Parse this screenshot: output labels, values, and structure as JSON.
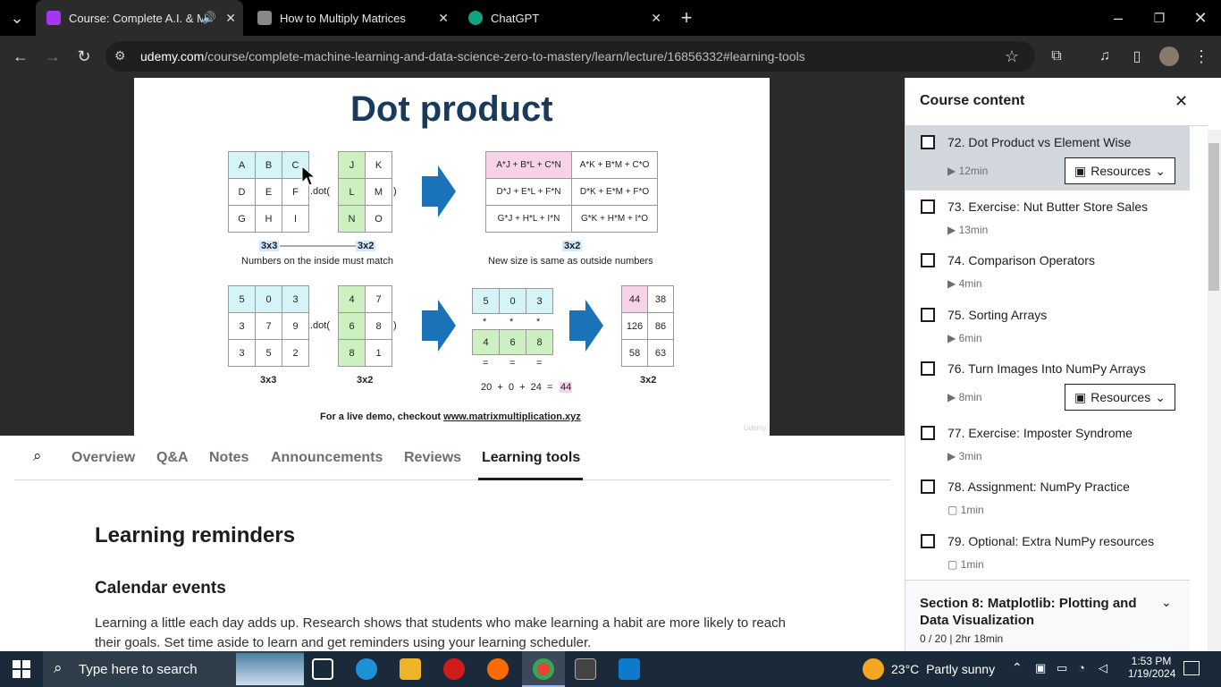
{
  "tabs": [
    {
      "title": "Course: Complete A.I. & Ma",
      "color": "#a435f0"
    },
    {
      "title": "How to Multiply Matrices",
      "color": "#888888"
    },
    {
      "title": "ChatGPT",
      "color": "#10a37f"
    }
  ],
  "url": {
    "domain": "udemy.com",
    "path": "/course/complete-machine-learning-and-data-science-zero-to-mastery/learn/lecture/16856332#learning-tools"
  },
  "slide": {
    "title": "Dot product",
    "m1": [
      [
        "A",
        "B",
        "C"
      ],
      [
        "D",
        "E",
        "F"
      ],
      [
        "G",
        "H",
        "I"
      ]
    ],
    "m2": [
      [
        "J",
        "K"
      ],
      [
        "L",
        "M"
      ],
      [
        "N",
        "O"
      ]
    ],
    "m3": [
      [
        "A*J + B*L + C*N",
        "A*K + B*M + C*O"
      ],
      [
        "D*J + E*L + F*N",
        "D*K + E*M + F*O"
      ],
      [
        "G*J + H*L + I*N",
        "G*K + H*M + I*O"
      ]
    ],
    "dot": ".dot(",
    "close": ")",
    "lbl_3x3": "3x3",
    "lbl_3x2": "3x2",
    "inside": "Numbers on the inside must match",
    "outside": "New size is same as outside numbers",
    "n1": [
      [
        "5",
        "0",
        "3"
      ],
      [
        "3",
        "7",
        "9"
      ],
      [
        "3",
        "5",
        "2"
      ]
    ],
    "n2": [
      [
        "4",
        "7"
      ],
      [
        "6",
        "8"
      ],
      [
        "8",
        "1"
      ]
    ],
    "row": [
      "5",
      "0",
      "3"
    ],
    "col": [
      "4",
      "6",
      "8"
    ],
    "star": "*",
    "eq": "=",
    "sum": "20  +  0  +  24  =",
    "sumres": "44",
    "res": [
      [
        "44",
        "38"
      ],
      [
        "126",
        "86"
      ],
      [
        "58",
        "63"
      ]
    ],
    "demo_pre": "For a live demo, checkout ",
    "demo_link": "www.matrixmultiplication.xyz",
    "watermark": "Udemy"
  },
  "navtabs": [
    "Overview",
    "Q&A",
    "Notes",
    "Announcements",
    "Reviews",
    "Learning tools"
  ],
  "content": {
    "h1": "Learning reminders",
    "h2": "Calendar events",
    "p": "Learning a little each day adds up. Research shows that students who make learning a habit are more likely to reach their goals. Set time aside to learn and get reminders using your learning scheduler."
  },
  "sidebar": {
    "title": "Course content",
    "items": [
      {
        "title": "72. Dot Product vs Element Wise",
        "dur": "12min",
        "res": true
      },
      {
        "title": "73. Exercise: Nut Butter Store Sales",
        "dur": "13min",
        "res": false
      },
      {
        "title": "74. Comparison Operators",
        "dur": "4min",
        "res": false
      },
      {
        "title": "75. Sorting Arrays",
        "dur": "6min",
        "res": false
      },
      {
        "title": "76. Turn Images Into NumPy Arrays",
        "dur": "8min",
        "res": true
      },
      {
        "title": "77. Exercise: Imposter Syndrome",
        "dur": "3min",
        "res": false
      },
      {
        "title": "78. Assignment: NumPy Practice",
        "dur": "1min",
        "res": false
      },
      {
        "title": "79. Optional: Extra NumPy resources",
        "dur": "1min",
        "res": false
      }
    ],
    "resources_label": "Resources",
    "section_title": "Section 8: Matplotlib: Plotting and Data Visualization",
    "section_meta": "0 / 20 | 2hr 18min"
  },
  "taskbar": {
    "search": "Type here to search",
    "temp": "23°C",
    "weather": "Partly sunny",
    "time": "1:53 PM",
    "date": "1/19/2024"
  },
  "colors": {
    "accent": "#a435f0",
    "arrow": "#1a73b8"
  }
}
